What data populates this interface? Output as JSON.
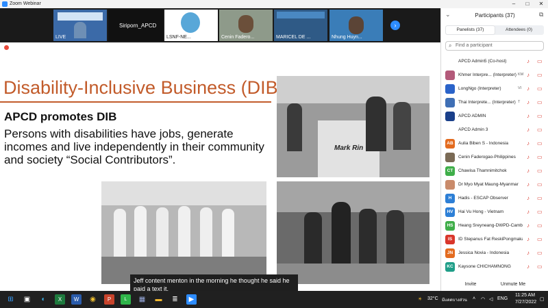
{
  "window": {
    "title": "Zoom Webinar"
  },
  "gallery": {
    "tiles": [
      {
        "label": "LIVE"
      },
      {
        "label": "Siriporn_APCD"
      },
      {
        "label": "LSNF-NE..."
      },
      {
        "label": "Cenin Fadero..."
      },
      {
        "label": "MARICEL DE ..."
      },
      {
        "label": "Nhung Huyn..."
      }
    ]
  },
  "slide": {
    "title": "Disability-Inclusive Business (DIB)",
    "subtitle": "APCD promotes DIB",
    "body": "Persons with disabilities have jobs, generate incomes and live independently in their community and society “Social Contributors”.",
    "sign_text": "Mark Rin"
  },
  "caption": {
    "text": "Jeff content menton in the morning he thought he said he paid a text it."
  },
  "participants": {
    "header": "Participants (37)",
    "tabs": [
      {
        "label": "Panelists (37)",
        "active": true
      },
      {
        "label": "Attendees (0)",
        "active": false
      }
    ],
    "search_placeholder": "Find a participant",
    "list": [
      {
        "initials": "",
        "name": "APCD Admin5 (Co-host)",
        "color": "#ffffff",
        "badge": ""
      },
      {
        "initials": "",
        "name": "Khmer Interpre... (Interpreter)",
        "color": "#b35a7a",
        "badge": "KM"
      },
      {
        "initials": "",
        "name": "LongNgo (Interpreter)",
        "color": "#2a63c9",
        "badge": "VI"
      },
      {
        "initials": "",
        "name": "Thai Interprete... (Interpreter)",
        "color": "#3f6fb5",
        "badge": "T"
      },
      {
        "initials": "",
        "name": "APCD ADMIN",
        "color": "#1a3f8a",
        "badge": ""
      },
      {
        "initials": "",
        "name": "APCD Admin 3",
        "color": "#ffffff",
        "badge": ""
      },
      {
        "initials": "AB",
        "name": "Aulia Biben S - Indonesia",
        "color": "#e36b1f",
        "badge": ""
      },
      {
        "initials": "",
        "name": "Cenin Faderogao-Philippines",
        "color": "#7a6a55",
        "badge": ""
      },
      {
        "initials": "CT",
        "name": "Chawisa Thamnimitchok",
        "color": "#3fae49",
        "badge": ""
      },
      {
        "initials": "",
        "name": "Dr Myo Myat Maung-Myanmar",
        "color": "#c98b6b",
        "badge": ""
      },
      {
        "initials": "H",
        "name": "Hadis - ESCAP Observer",
        "color": "#2d7fd6",
        "badge": ""
      },
      {
        "initials": "HV",
        "name": "Hai Vu Hong - Vietnam",
        "color": "#2d7fd6",
        "badge": ""
      },
      {
        "initials": "HS",
        "name": "Heang Sreyneang-DWPD-Camb...",
        "color": "#3fae49",
        "badge": ""
      },
      {
        "initials": "IS",
        "name": "ID Stepanus Fat ReskiPongmaka...",
        "color": "#d9362b",
        "badge": ""
      },
      {
        "initials": "JN",
        "name": "Jessica Novia - Indonesia",
        "color": "#e36b1f",
        "badge": ""
      },
      {
        "initials": "KC",
        "name": "Kaysone CHICHAMNONG",
        "color": "#1f9e88",
        "badge": ""
      }
    ],
    "invite_label": "Invite",
    "mute_label": "Unmute Me"
  },
  "taskbar": {
    "weather": "32°C",
    "weather_text": "มีแดดบางส่วน",
    "lang": "ENG",
    "time": "11:25 AM",
    "date": "7/27/2022"
  },
  "colors": {
    "accent": "#c25b2a",
    "zoom_blue": "#2d8cff",
    "mute_red": "#d9362b"
  }
}
